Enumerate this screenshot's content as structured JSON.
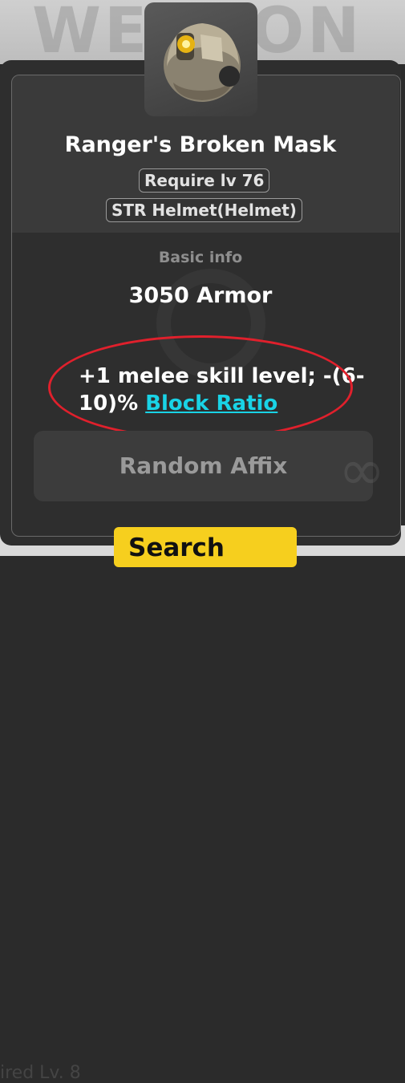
{
  "background": {
    "watermark": "WEAPON",
    "footer_text": "ired Lv. 8"
  },
  "item": {
    "icon": "helmet-icon",
    "name": "Ranger's Broken Mask",
    "require_level": "Require lv 76",
    "item_type": "STR Helmet(Helmet)"
  },
  "basic_info": {
    "label": "Basic info",
    "armor": "3050 Armor"
  },
  "affix": {
    "text": "+1 melee skill level; -(6-10)% ",
    "link": "Block Ratio"
  },
  "random_affix": {
    "label": "Random Affix",
    "icon": "infinity-icon"
  },
  "search": {
    "label": "Search"
  },
  "colors": {
    "highlight_ring": "#e0202c",
    "link": "#19d3e6",
    "search_button": "#f6cf1e"
  }
}
